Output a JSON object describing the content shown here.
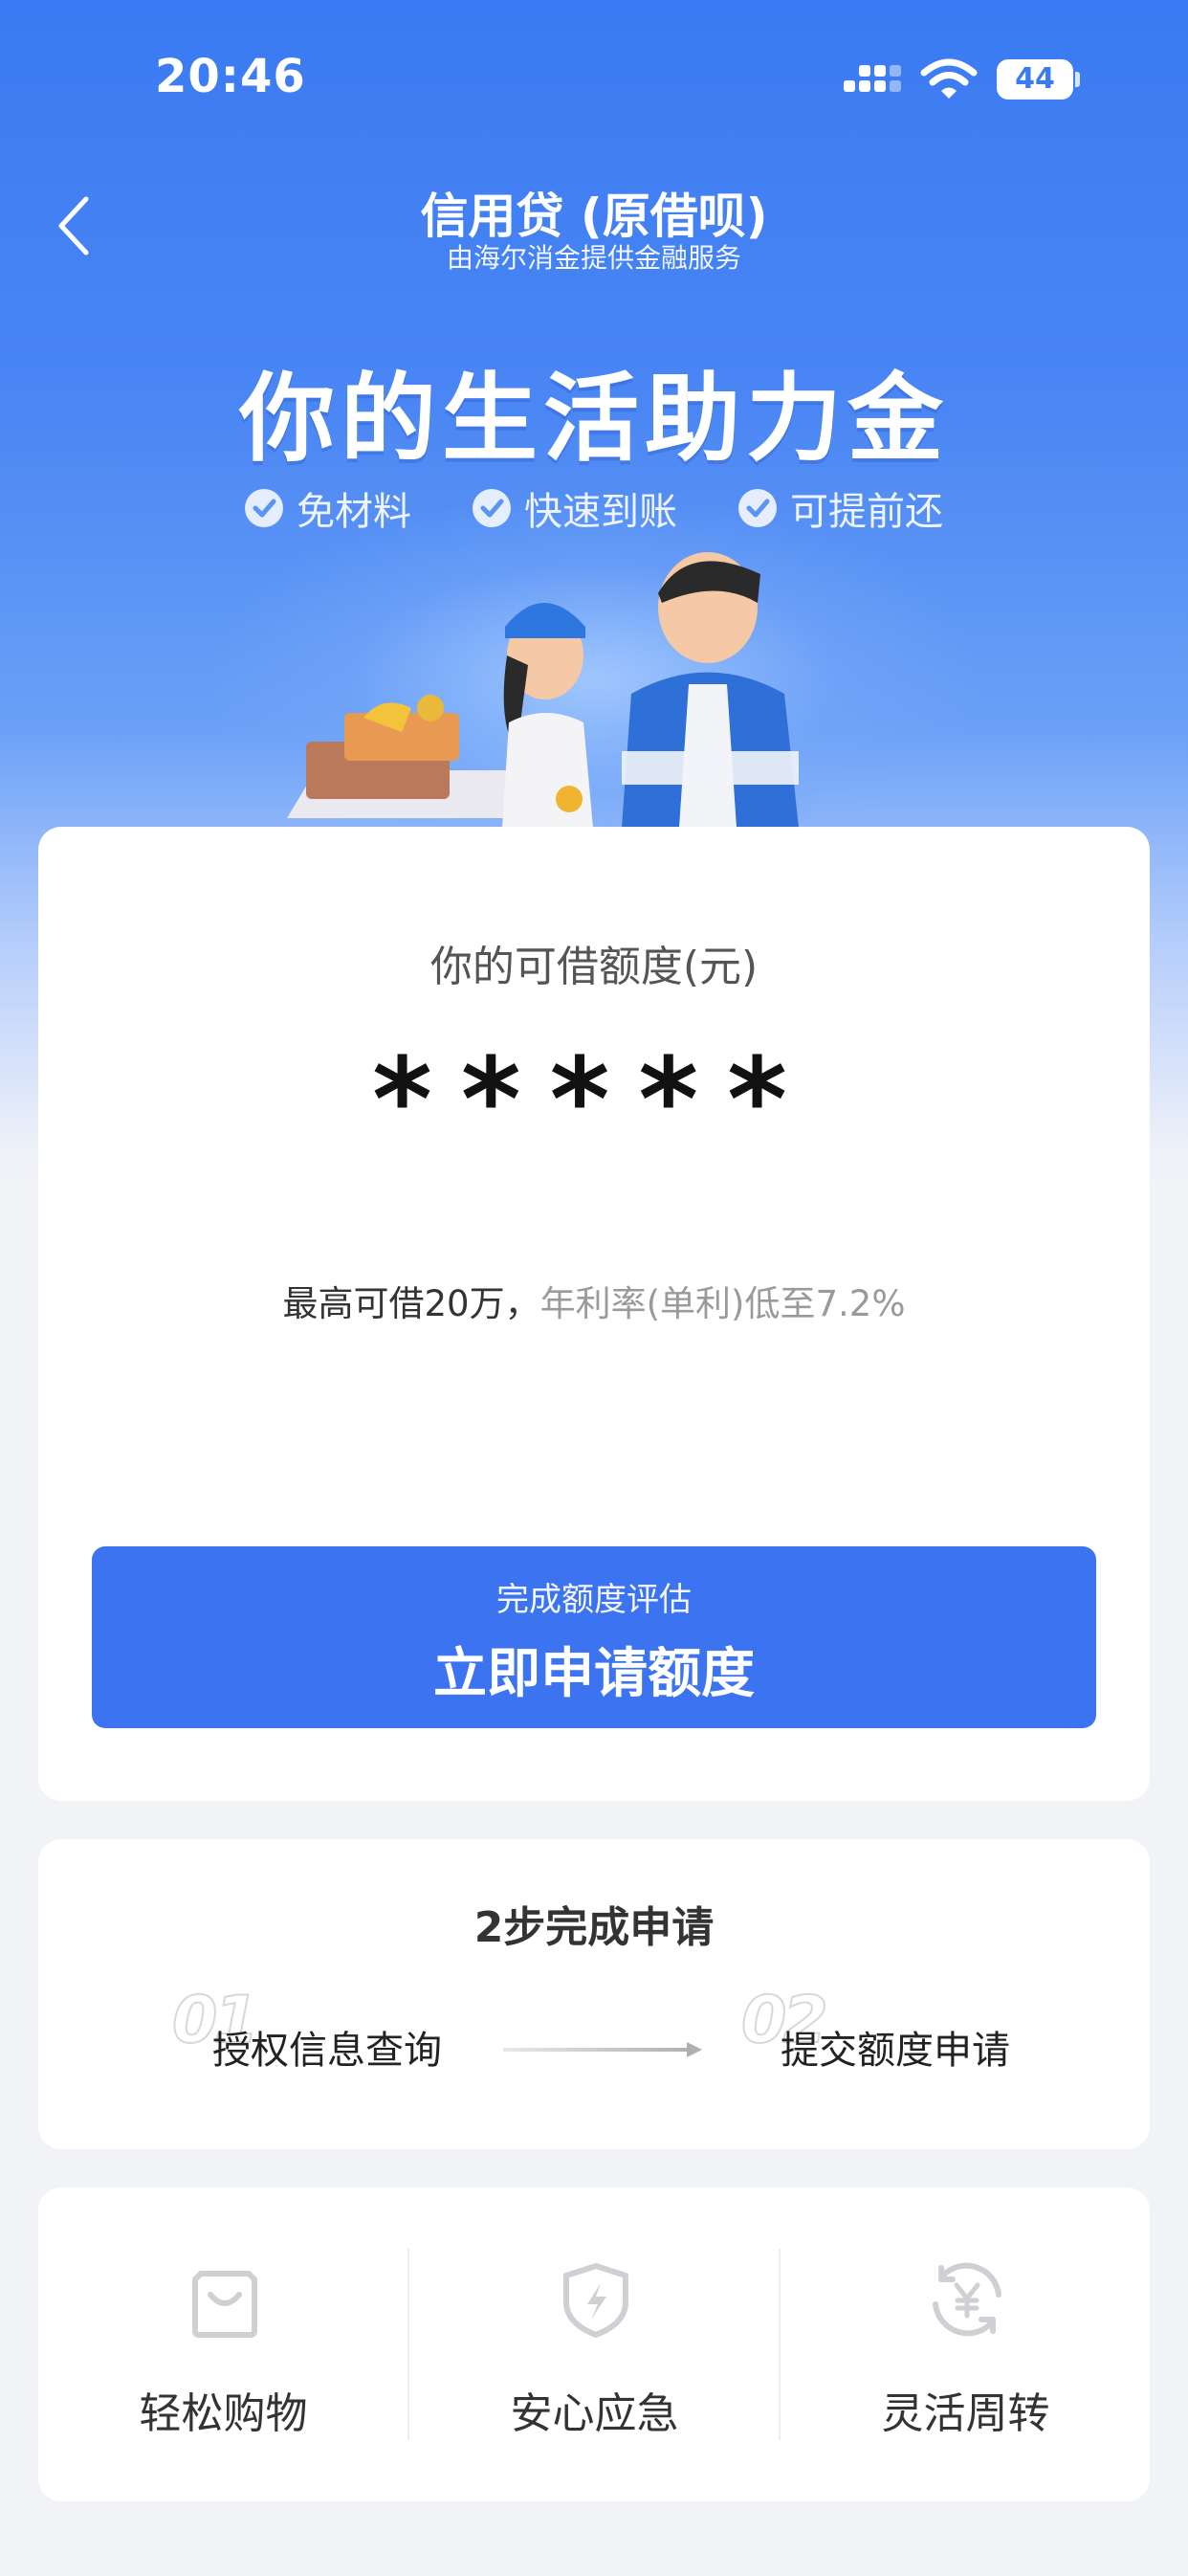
{
  "status": {
    "time": "20:46",
    "battery": "44"
  },
  "nav": {
    "title": "信用贷 (原借呗)",
    "subtitle": "由海尔消金提供金融服务"
  },
  "hero": {
    "slogan": "你的生活助力金",
    "features": [
      "免材料",
      "快速到账",
      "可提前还"
    ]
  },
  "limit": {
    "label": "你的可借额度(元)",
    "value": "*****",
    "info_max": "最高可借20万，",
    "info_rate": "年利率(单利)低至7.2%"
  },
  "apply": {
    "sub": "完成额度评估",
    "main": "立即申请额度"
  },
  "steps": {
    "title": "2步完成申请",
    "items": [
      {
        "num": "01",
        "label": "授权信息查询"
      },
      {
        "num": "02",
        "label": "提交额度申请"
      }
    ]
  },
  "benefits": [
    {
      "label": "轻松购物",
      "icon": "shopping-bag-icon"
    },
    {
      "label": "安心应急",
      "icon": "shield-bolt-icon"
    },
    {
      "label": "灵活周转",
      "icon": "yuan-cycle-icon"
    }
  ],
  "colors": {
    "primary": "#3b73f0",
    "hero_top": "#3a7af2",
    "background": "#f2f3f7"
  }
}
